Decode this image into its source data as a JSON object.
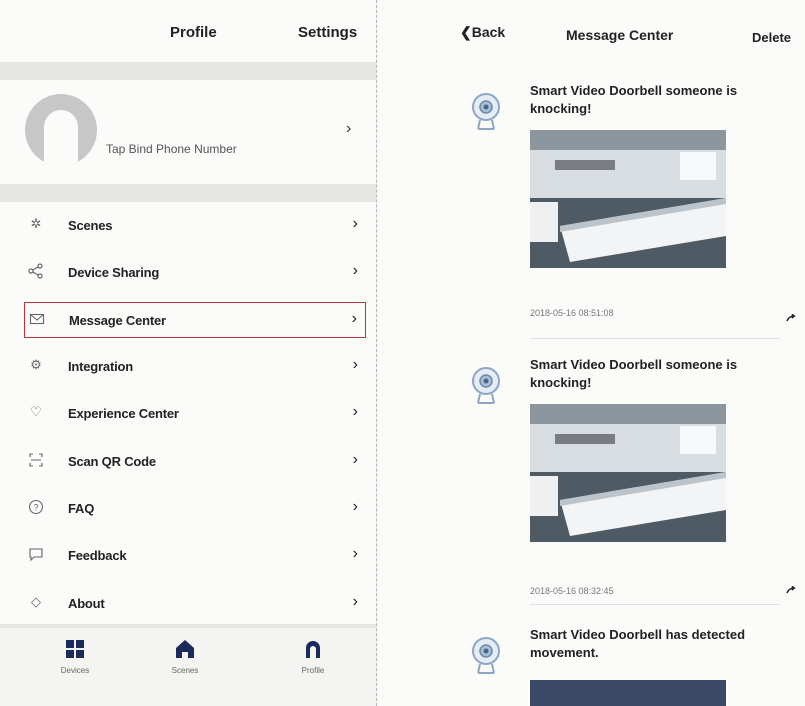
{
  "profile_screen": {
    "header": {
      "title": "Profile",
      "settings_label": "Settings"
    },
    "user": {
      "bind_phone_text": "Tap Bind Phone Number"
    },
    "menu": [
      {
        "label": "Scenes",
        "icon": "scenes-icon"
      },
      {
        "label": "Device Sharing",
        "icon": "share-icon"
      },
      {
        "label": "Message Center",
        "icon": "mail-icon",
        "selected": true
      },
      {
        "label": "Integration",
        "icon": "integration-icon"
      },
      {
        "label": "Experience Center",
        "icon": "heart-icon"
      },
      {
        "label": "Scan QR Code",
        "icon": "scan-icon"
      },
      {
        "label": "FAQ",
        "icon": "help-icon"
      },
      {
        "label": "Feedback",
        "icon": "feedback-icon"
      },
      {
        "label": "About",
        "icon": "about-icon"
      }
    ],
    "chevron": "›",
    "tabs": [
      {
        "label": "Devices",
        "icon": "devices-grid-icon"
      },
      {
        "label": "Scenes",
        "icon": "home-icon"
      },
      {
        "label": "Profile",
        "icon": "profile-icon",
        "active": true
      }
    ]
  },
  "message_screen": {
    "header": {
      "back_label": "Back",
      "title": "Message Center",
      "delete_label": "Delete"
    },
    "messages": [
      {
        "text": "Smart  Video Doorbell someone is knocking!",
        "timestamp": "2018-05-16 08:51:08"
      },
      {
        "text": "Smart  Video Doorbell someone is knocking!",
        "timestamp": "2018-05-16 08:32:45"
      },
      {
        "text": "Smart  Video Doorbell has detected movement.",
        "timestamp": ""
      }
    ]
  },
  "colors": {
    "selected_border": "#b03a3a",
    "active_tab": "#1a2a5a",
    "icon_gray": "#666666"
  }
}
